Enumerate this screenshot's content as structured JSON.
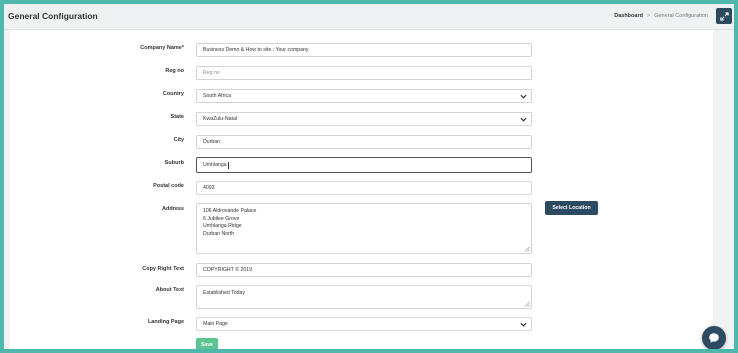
{
  "header": {
    "title": "General Configuration",
    "breadcrumb": {
      "home": "Dashboard",
      "separator": ">",
      "current": "General Configuration"
    }
  },
  "form": {
    "company_name": {
      "label": "Company Name*",
      "value": "Business Demo & How to site : Your company"
    },
    "reg_no": {
      "label": "Reg no",
      "placeholder": "Reg no"
    },
    "country": {
      "label": "Country",
      "value": "South Africa"
    },
    "state": {
      "label": "State",
      "value": "KwaZulu-Natal"
    },
    "city": {
      "label": "City",
      "value": "Durban"
    },
    "suburb": {
      "label": "Suburb",
      "value": "Umhlanga"
    },
    "postal_code": {
      "label": "Postal code",
      "value": "4093"
    },
    "address": {
      "label": "Address",
      "lines": [
        "106 Aldrovande Palace",
        "6 Jubilee Grove",
        "Umhlanga Ridge",
        "Durban North"
      ],
      "select_location_label": "Select Location"
    },
    "copyright": {
      "label": "Copy Right Text",
      "value": "COPYRIGHT © 2019"
    },
    "about": {
      "label": "About Text",
      "value": "Established Today"
    },
    "landing_page": {
      "label": "Landing Page",
      "value": "Main Page"
    },
    "save_label": "Save"
  },
  "colors": {
    "frame": "#4fb7ac",
    "primary": "#2d4a63",
    "save": "#5cc58f"
  },
  "icons": {
    "expand": "expand-icon",
    "dropdown": "chevron-down-icon",
    "chat": "chat-icon"
  }
}
